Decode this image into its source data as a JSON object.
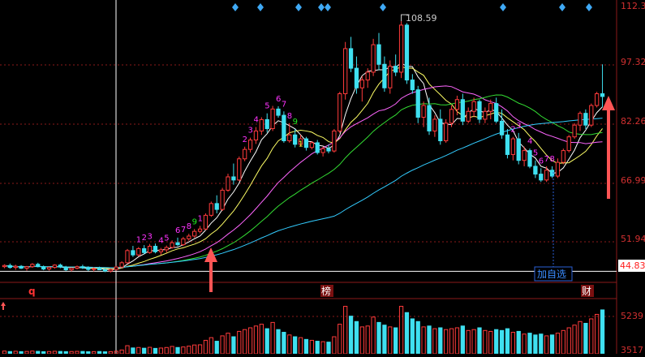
{
  "colors": {
    "up": "#ff3b3b",
    "down": "#3fe0f0",
    "ma5": "#ffffff",
    "ma10": "#ffff66",
    "ma20": "#ff66ff",
    "ma30": "#33dd33",
    "ma60": "#33ccff",
    "grid": "#8b1a1a",
    "axis_text": "#d23030",
    "td_up": "#ff33ff",
    "td_9": "#22ee22",
    "td_down": "#ffff33",
    "marker": "#3fa9f5"
  },
  "price_axis": {
    "ticks": [
      "112.35",
      "97.32",
      "82.26",
      "66.99",
      "51.94"
    ],
    "current": "44.83"
  },
  "volume_axis": {
    "ticks": [
      "5239",
      "3517"
    ]
  },
  "annotations": {
    "high_label": "108.59",
    "add_watchlist": "加自选",
    "tag_q": "q",
    "tag_bang": "榜",
    "tag_cai": "财"
  },
  "td_labels": [
    "1",
    "2",
    "3",
    "4",
    "5",
    "6",
    "7",
    "8",
    "9",
    "1",
    "2",
    "3",
    "4",
    "5",
    "6",
    "7",
    "8",
    "9",
    "1",
    "2",
    "3",
    "4",
    "5",
    "6",
    "7",
    "8"
  ],
  "chart_data": {
    "type": "candlestick",
    "ylim": [
      42,
      114
    ],
    "high": 108.59,
    "last": 44.83,
    "candles": [
      [
        46,
        46.6,
        45.6,
        46.3
      ],
      [
        46.3,
        46.8,
        45.5,
        45.8
      ],
      [
        45.8,
        46.5,
        45.2,
        46.1
      ],
      [
        46.1,
        46.4,
        45.4,
        45.6
      ],
      [
        45.6,
        46.2,
        45.0,
        46.0
      ],
      [
        46.0,
        46.9,
        45.7,
        46.6
      ],
      [
        46.6,
        47.0,
        45.8,
        46.0
      ],
      [
        46.0,
        46.3,
        45.1,
        45.4
      ],
      [
        45.4,
        46.0,
        45.0,
        45.8
      ],
      [
        45.8,
        46.6,
        45.5,
        46.4
      ],
      [
        46.4,
        46.8,
        45.6,
        45.9
      ],
      [
        45.9,
        46.2,
        44.9,
        45.2
      ],
      [
        45.2,
        45.8,
        44.8,
        45.6
      ],
      [
        45.6,
        46.3,
        45.3,
        46.0
      ],
      [
        46.0,
        46.5,
        45.4,
        45.7
      ],
      [
        45.7,
        46.1,
        44.9,
        45.3
      ],
      [
        45.3,
        45.9,
        44.8,
        45.5
      ],
      [
        45.5,
        46.0,
        45.1,
        45.2
      ],
      [
        45.2,
        45.6,
        44.6,
        44.9
      ],
      [
        44.9,
        45.5,
        44.5,
        45.3
      ],
      [
        45.3,
        46.2,
        45.0,
        45.9
      ],
      [
        45.9,
        47.4,
        45.6,
        47.0
      ],
      [
        47.0,
        50.5,
        46.8,
        50.1
      ],
      [
        50.1,
        51.3,
        48.5,
        49.0
      ],
      [
        49.0,
        51.0,
        48.6,
        50.6
      ],
      [
        50.6,
        51.5,
        49.2,
        49.6
      ],
      [
        49.6,
        51.8,
        49.3,
        51.2
      ],
      [
        51.2,
        51.9,
        49.4,
        49.8
      ],
      [
        49.8,
        50.8,
        49.0,
        50.3
      ],
      [
        50.3,
        51.4,
        49.6,
        50.9
      ],
      [
        50.9,
        52.7,
        50.6,
        52.1
      ],
      [
        52.1,
        53.4,
        51.2,
        51.6
      ],
      [
        51.6,
        53.6,
        51.3,
        53.1
      ],
      [
        53.1,
        54.4,
        52.6,
        53.8
      ],
      [
        53.8,
        55.6,
        53.4,
        55.0
      ],
      [
        55.0,
        56.4,
        54.5,
        55.6
      ],
      [
        55.6,
        59.6,
        55.3,
        59.1
      ],
      [
        59.1,
        62.6,
        58.7,
        62.1
      ],
      [
        62.1,
        64.2,
        59.6,
        60.6
      ],
      [
        60.6,
        66.1,
        60.2,
        65.5
      ],
      [
        65.5,
        69.7,
        65.1,
        68.9
      ],
      [
        68.9,
        72.3,
        66.9,
        68.1
      ],
      [
        68.1,
        74.1,
        67.8,
        73.5
      ],
      [
        73.5,
        76.6,
        72.9,
        75.9
      ],
      [
        75.9,
        78.9,
        75.1,
        78.3
      ],
      [
        78.3,
        81.6,
        77.3,
        80.6
      ],
      [
        80.6,
        84.1,
        79.6,
        83.5
      ],
      [
        83.5,
        85.1,
        80.2,
        81.2
      ],
      [
        81.2,
        87.0,
        80.6,
        86.2
      ],
      [
        86.2,
        86.9,
        84.0,
        84.6
      ],
      [
        84.6,
        85.6,
        77.6,
        78.1
      ],
      [
        78.1,
        82.6,
        77.6,
        79.6
      ],
      [
        79.6,
        81.1,
        76.4,
        77.2
      ],
      [
        77.2,
        79.6,
        76.6,
        78.6
      ],
      [
        78.6,
        79.1,
        75.6,
        76.4
      ],
      [
        76.4,
        78.0,
        75.9,
        77.6
      ],
      [
        77.6,
        78.3,
        74.6,
        75.1
      ],
      [
        75.1,
        76.6,
        74.1,
        76.1
      ],
      [
        76.1,
        77.1,
        74.9,
        75.5
      ],
      [
        75.5,
        81.1,
        75.1,
        80.6
      ],
      [
        80.6,
        90.6,
        80.1,
        90.1
      ],
      [
        90.1,
        103.3,
        88.6,
        101.6
      ],
      [
        101.6,
        104.6,
        95.6,
        96.6
      ],
      [
        96.6,
        99.6,
        90.1,
        91.6
      ],
      [
        91.6,
        94.6,
        88.1,
        93.6
      ],
      [
        93.6,
        96.6,
        91.6,
        95.6
      ],
      [
        95.6,
        104.1,
        94.6,
        102.6
      ],
      [
        102.6,
        105.6,
        96.1,
        97.6
      ],
      [
        97.6,
        99.6,
        90.6,
        91.6
      ],
      [
        91.6,
        98.6,
        90.1,
        97.1
      ],
      [
        97.1,
        100.1,
        94.6,
        95.6
      ],
      [
        95.6,
        108.59,
        94.1,
        107.6
      ],
      [
        107.6,
        108.1,
        92.6,
        93.6
      ],
      [
        93.6,
        95.1,
        90.1,
        91.1
      ],
      [
        91.1,
        92.1,
        82.6,
        84.1
      ],
      [
        84.1,
        88.1,
        81.6,
        87.1
      ],
      [
        87.1,
        89.1,
        79.6,
        80.6
      ],
      [
        80.6,
        84.6,
        79.1,
        83.6
      ],
      [
        83.6,
        86.1,
        77.1,
        78.1
      ],
      [
        78.1,
        83.6,
        77.6,
        82.6
      ],
      [
        82.6,
        87.1,
        81.6,
        86.1
      ],
      [
        86.1,
        89.6,
        84.6,
        88.6
      ],
      [
        88.6,
        90.1,
        82.1,
        83.1
      ],
      [
        83.1,
        86.6,
        82.6,
        85.6
      ],
      [
        85.6,
        89.1,
        84.1,
        88.1
      ],
      [
        88.1,
        88.6,
        82.6,
        83.6
      ],
      [
        83.6,
        86.6,
        82.6,
        85.6
      ],
      [
        85.6,
        88.6,
        83.6,
        87.6
      ],
      [
        87.6,
        89.1,
        82.6,
        83.1
      ],
      [
        83.1,
        86.1,
        78.6,
        79.6
      ],
      [
        79.6,
        81.1,
        73.6,
        74.6
      ],
      [
        74.6,
        79.1,
        73.1,
        78.6
      ],
      [
        78.6,
        80.1,
        72.1,
        73.1
      ],
      [
        73.1,
        76.6,
        71.6,
        75.6
      ],
      [
        75.6,
        76.1,
        71.1,
        71.6
      ],
      [
        71.6,
        73.1,
        68.6,
        69.6
      ],
      [
        69.6,
        71.1,
        67.6,
        68.1
      ],
      [
        68.1,
        71.6,
        67.6,
        70.6
      ],
      [
        70.6,
        71.6,
        68.6,
        69.1
      ],
      [
        69.1,
        73.6,
        68.6,
        72.6
      ],
      [
        72.6,
        76.1,
        72.1,
        75.6
      ],
      [
        75.6,
        79.6,
        75.1,
        79.1
      ],
      [
        79.1,
        82.6,
        78.6,
        82.1
      ],
      [
        82.1,
        85.6,
        80.6,
        85.1
      ],
      [
        85.1,
        86.1,
        81.1,
        82.1
      ],
      [
        82.1,
        87.6,
        81.6,
        87.1
      ],
      [
        87.1,
        90.6,
        86.6,
        90.1
      ],
      [
        90.1,
        97.6,
        86.6,
        89.4
      ]
    ],
    "volume_ylim": [
      0,
      5800
    ],
    "volume": [
      300,
      250,
      280,
      240,
      260,
      300,
      270,
      230,
      250,
      280,
      260,
      240,
      250,
      270,
      260,
      230,
      240,
      250,
      220,
      240,
      280,
      420,
      900,
      650,
      700,
      620,
      720,
      600,
      640,
      700,
      820,
      700,
      760,
      850,
      980,
      1000,
      1500,
      1800,
      1400,
      2000,
      2300,
      1900,
      2500,
      2700,
      2900,
      3100,
      3300,
      2800,
      3500,
      2700,
      2400,
      2100,
      1900,
      1800,
      1600,
      1500,
      1400,
      1350,
      1300,
      1900,
      3300,
      5300,
      4200,
      3600,
      3000,
      3100,
      4100,
      3500,
      3200,
      3000,
      2900,
      5300,
      4600,
      3900,
      3600,
      3000,
      3100,
      2800,
      2900,
      2700,
      2800,
      2900,
      3100,
      2600,
      2700,
      2900,
      2600,
      2500,
      2700,
      2600,
      2800,
      2400,
      2500,
      2200,
      2300,
      2100,
      2200,
      2000,
      2100,
      2300,
      2600,
      2900,
      3200,
      3600,
      3400,
      3900,
      4400,
      4900
    ]
  }
}
